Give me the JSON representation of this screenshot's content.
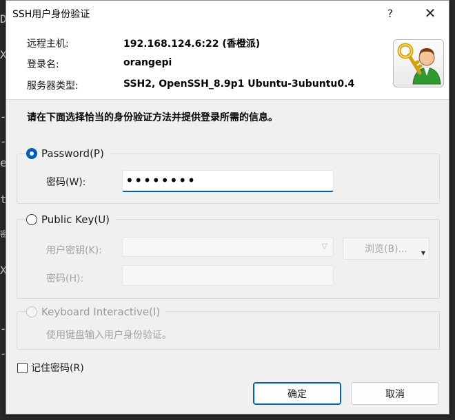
{
  "window": {
    "title": "SSH用户身份验证",
    "help_glyph": "?",
    "close_glyph": "✕"
  },
  "info": {
    "host_label": "远程主机:",
    "host_value": "192.168.124.6:22 (香橙派)",
    "login_label": "登录名:",
    "login_value": "orangepi",
    "server_type_label": "服务器类型:",
    "server_type_value": "SSH2, OpenSSH_8.9p1 Ubuntu-3ubuntu0.4"
  },
  "instruction": "请在下面选择恰当的身份验证方法并提供登录所需的信息。",
  "password_method": {
    "label": "Password(P)",
    "selected": true,
    "field_label": "密码(W):",
    "field_value": "••••••••"
  },
  "public_key_method": {
    "label": "Public Key(U)",
    "selected": false,
    "user_key_label": "用户密钥(K):",
    "browse_label": "浏览(B)...",
    "passphrase_label": "密码(H):"
  },
  "keyboard_method": {
    "label": "Keyboard Interactive(I)",
    "selected": false,
    "enabled": false,
    "description": "使用键盘输入用户身份验证。"
  },
  "remember_password": {
    "label": "记住密码(R)",
    "checked": false
  },
  "buttons": {
    "ok": "确定",
    "cancel": "取消"
  },
  "colors": {
    "accent": "#005fb8",
    "disabled_text": "#a2a2a2"
  },
  "icons": {
    "header": "user-key-icon",
    "dropdown": "chevron-down-icon"
  },
  "background_fragments": [
    "D",
    "X",
    "-",
    "-",
    "e",
    "t",
    "密",
    "X",
    "-",
    "-"
  ]
}
